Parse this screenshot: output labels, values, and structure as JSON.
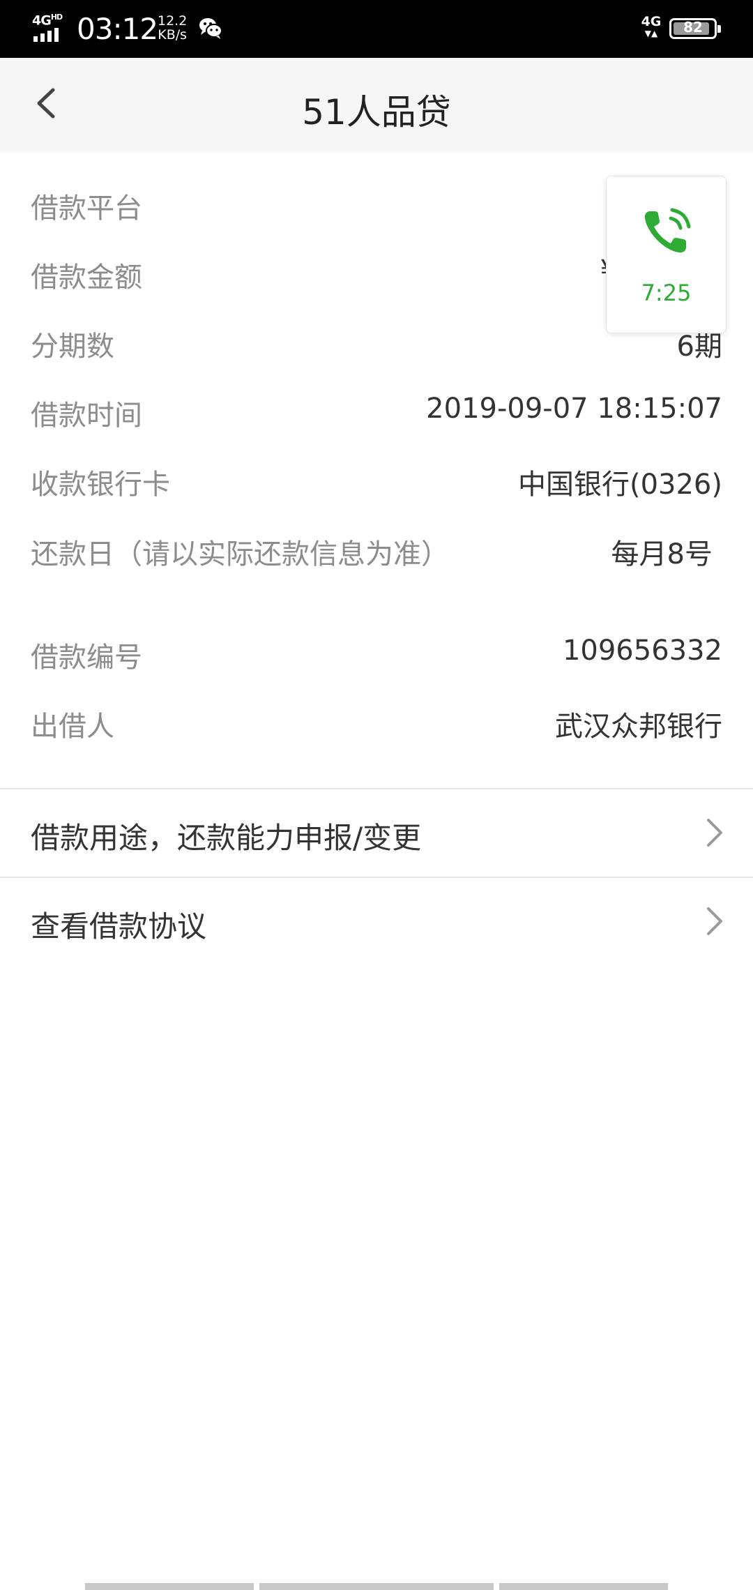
{
  "status_bar": {
    "network_left": "4G",
    "network_left_sup": "HD",
    "time": "03:12",
    "speed_value": "12.2",
    "speed_unit": "KB/s",
    "network_right": "4G",
    "battery": "82"
  },
  "header": {
    "title": "51人品贷"
  },
  "details": [
    {
      "label": "借款平台",
      "value": ""
    },
    {
      "label": "借款金额",
      "value": "¥"
    },
    {
      "label": "分期数",
      "value": "6期"
    },
    {
      "label": "借款时间",
      "value": "2019-09-07 18:15:07"
    },
    {
      "label": "收款银行卡",
      "value": "中国银行(0326)"
    },
    {
      "label": "还款日（请以实际还款信息为准）",
      "value": "每月8号"
    },
    {
      "label": "借款编号",
      "value": "109656332"
    },
    {
      "label": "出借人",
      "value": "武汉众邦银行"
    }
  ],
  "links": [
    {
      "label": "借款用途，还款能力申报/变更"
    },
    {
      "label": "查看借款协议"
    }
  ],
  "call_widget": {
    "timer": "7:25",
    "color": "#2dab35"
  }
}
